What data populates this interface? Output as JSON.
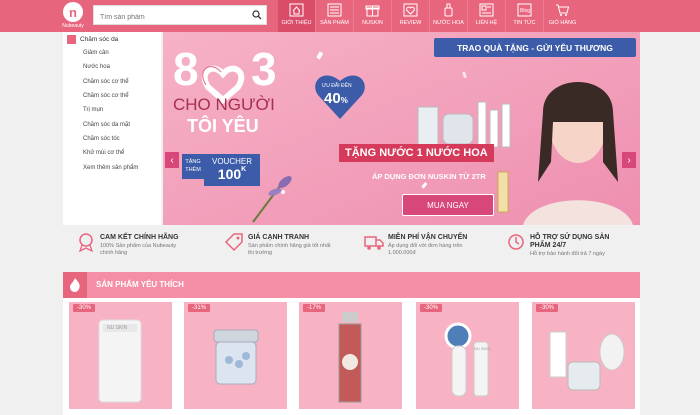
{
  "header": {
    "logo_letter": "n",
    "logo_name": "Nubeauty",
    "search_placeholder": "Tìm sản phẩm",
    "nav": [
      {
        "label": "GIỚI THIỆU",
        "icon": "home-icon"
      },
      {
        "label": "SẢN PHẨM",
        "icon": "grid-icon"
      },
      {
        "label": "NUSKIN",
        "icon": "gift-icon"
      },
      {
        "label": "REVIEW",
        "icon": "heart-icon"
      },
      {
        "label": "NƯỚC HOA",
        "icon": "perfume-icon"
      },
      {
        "label": "LIÊN HỆ",
        "icon": "contact-icon"
      },
      {
        "label": "TIN TỨC",
        "icon": "news-icon"
      },
      {
        "label": "GIỎ HÀNG",
        "icon": "cart-icon"
      }
    ]
  },
  "sidebar": {
    "head": "Chăm sóc da",
    "items": [
      "Giảm cân",
      "Nước hoa",
      "Chăm sóc cơ thể",
      "Chăm sóc cơ thể",
      "Trị mụn",
      "Chăm sóc da mặt",
      "Chăm sóc tóc",
      "Khử mùi cơ thể",
      "Xem thêm sản phẩm"
    ]
  },
  "banner": {
    "big_text_left": "8",
    "big_text_right": "3",
    "line1": "CHO NGƯỜI",
    "line2": "TÔI YÊU",
    "tag_top": "TẶNG",
    "tag_bottom": "THÊM",
    "voucher_label": "VOUCHER",
    "voucher_value": "100",
    "voucher_unit": "K",
    "heart_small": "ƯU ĐÃI ĐẾN",
    "heart_big": "40",
    "heart_unit": "%",
    "ribbon": "TRAO QUÀ TẶNG - GỬI YÊU THƯƠNG",
    "gift_text": "TẶNG NƯỚC 1 NƯỚC HOA",
    "apply_text": "ÁP DỤNG ĐƠN NUSKIN TỪ 2TR",
    "cta": "MUA NGAY",
    "prev": "‹",
    "next": "›"
  },
  "benefits": [
    {
      "title": "CAM KẾT CHÍNH HÃNG",
      "desc1": "100% Sản phẩm của Nubeauty",
      "desc2": "chính hãng"
    },
    {
      "title": "GIÁ CẠNH TRANH",
      "desc1": "Sản phẩm chính hãng giá tốt nhất",
      "desc2": "thị trường"
    },
    {
      "title": "MIỄN PHÍ VẬN CHUYỂN",
      "desc1": "Áp dụng đối với đơn hàng trên",
      "desc2": "1.000.000đ"
    },
    {
      "title": "HỖ TRỢ SỬ DỤNG SẢN",
      "desc1": "PHẨM 24/7",
      "desc2": "Hỗ trợ bảo hành đổi trả 7 ngày"
    }
  ],
  "favorites": {
    "title": "SẢN PHẨM YÊU THÍCH",
    "products": [
      {
        "discount": "-30%",
        "brand": "NU SKIN"
      },
      {
        "discount": "-31%",
        "brand": ""
      },
      {
        "discount": "-17%",
        "brand": ""
      },
      {
        "discount": "-30%",
        "brand": "NU SKIN"
      },
      {
        "discount": "-30%",
        "brand": ""
      }
    ]
  },
  "colors": {
    "brand": "#e8657e",
    "banner_bg": "#f3a3bd",
    "accent": "#d8477a"
  }
}
